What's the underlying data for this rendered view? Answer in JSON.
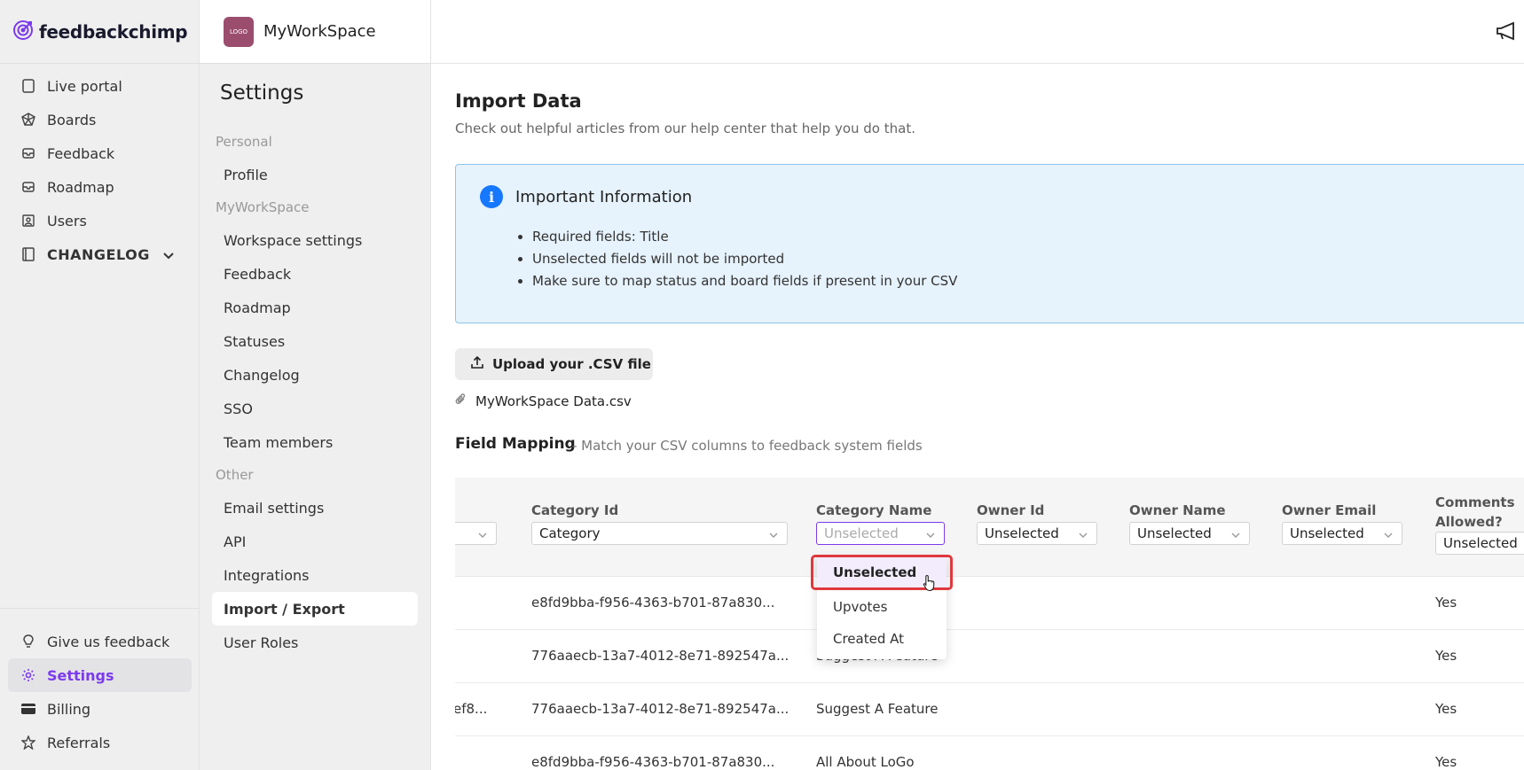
{
  "brand": {
    "name": "feedbackchimp"
  },
  "nav": {
    "items": [
      {
        "label": "Live portal",
        "icon": "tablet-icon"
      },
      {
        "label": "Boards",
        "icon": "boards-icon"
      },
      {
        "label": "Feedback",
        "icon": "inbox-icon"
      },
      {
        "label": "Roadmap",
        "icon": "roadmap-icon"
      },
      {
        "label": "Users",
        "icon": "users-icon"
      },
      {
        "label": "CHANGELOG",
        "icon": "book-icon"
      }
    ],
    "bottom": [
      {
        "label": "Give us feedback",
        "icon": "lightbulb-icon"
      },
      {
        "label": "Settings",
        "icon": "gear-icon"
      },
      {
        "label": "Billing",
        "icon": "card-icon"
      },
      {
        "label": "Referrals",
        "icon": "star-icon"
      }
    ]
  },
  "workspace": {
    "name": "MyWorkSpace",
    "logo_text": "LOGO"
  },
  "settings": {
    "title": "Settings",
    "sections": {
      "personal": "Personal",
      "workspace": "MyWorkSpace",
      "other": "Other"
    },
    "personal_items": [
      "Profile"
    ],
    "workspace_items": [
      "Workspace settings",
      "Feedback",
      "Roadmap",
      "Statuses",
      "Changelog",
      "SSO",
      "Team members"
    ],
    "other_items": [
      "Email settings",
      "API",
      "Integrations",
      "Import / Export",
      "User Roles"
    ]
  },
  "page": {
    "title": "Import Data",
    "subtitle": "Check out helpful articles from our help center that help you do that."
  },
  "info": {
    "title": "Important Information",
    "bullets": [
      "Required fields: Title",
      "Unselected fields will not be imported",
      "Make sure to map status and board fields if present in your CSV"
    ]
  },
  "upload": {
    "label": "Upload your .CSV file",
    "file_name": "MyWorkSpace Data.csv"
  },
  "field_mapping": {
    "title": "Field Mapping",
    "subtitle": "- Match your CSV columns to feedback system fields"
  },
  "table": {
    "columns": [
      {
        "label": "",
        "value": ""
      },
      {
        "label": "Category Id",
        "value": "Category"
      },
      {
        "label": "Category Name",
        "value": "Unselected"
      },
      {
        "label": "Owner Id",
        "value": "Unselected"
      },
      {
        "label": "Owner Name",
        "value": "Unselected"
      },
      {
        "label": "Owner Email",
        "value": "Unselected"
      },
      {
        "label": "Comments Allowed?",
        "label_line1": "Comments",
        "label_line2": "Allowed?",
        "value": "Unselected"
      }
    ],
    "rows": [
      {
        "c0": "",
        "c1": "e8fd9bba-f956-4363-b701-87a830...",
        "c2": "",
        "c6": "Yes"
      },
      {
        "c0": "",
        "c1": "776aaecb-13a7-4012-8e71-892547a...",
        "c2": "Suggest A Feature",
        "c6": "Yes"
      },
      {
        "c0": "ef8...",
        "c1": "776aaecb-13a7-4012-8e71-892547a...",
        "c2": "Suggest A Feature",
        "c6": "Yes"
      },
      {
        "c0": "",
        "c1": "e8fd9bba-f956-4363-b701-87a830...",
        "c2": "All About LoGo",
        "c6": "Yes"
      }
    ]
  },
  "dropdown": {
    "options": [
      "Unselected",
      "Upvotes",
      "Created At"
    ],
    "selected": "Unselected"
  },
  "colors": {
    "accent": "#7c3aed",
    "info_bg": "#e6f2fc",
    "info_border": "#8cc4ec",
    "highlight": "#e0383e"
  }
}
